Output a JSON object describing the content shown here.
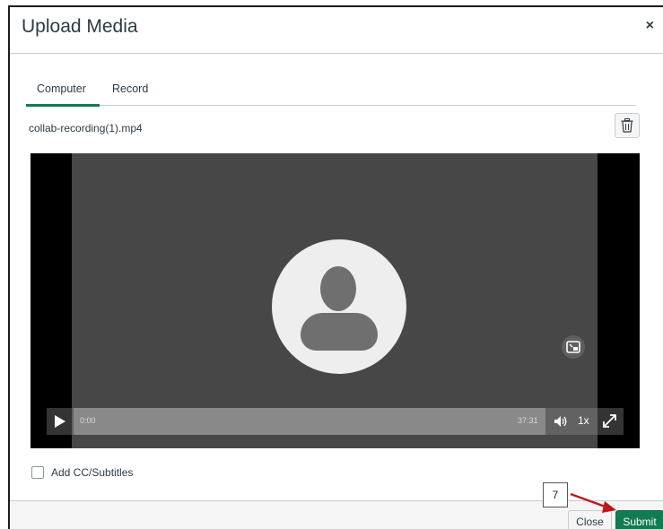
{
  "dialog": {
    "title": "Upload Media",
    "close_symbol": "×"
  },
  "tabs": [
    {
      "label": "Computer",
      "active": true
    },
    {
      "label": "Record",
      "active": false
    }
  ],
  "file": {
    "name": "collab-recording(1).mp4"
  },
  "player": {
    "current_time": "0:00",
    "duration": "37:31",
    "speed": "1x",
    "progress": 0.0
  },
  "captions": {
    "label": "Add CC/Subtitles",
    "checked": false
  },
  "footer": {
    "close_label": "Close",
    "submit_label": "Submit"
  },
  "annotation": {
    "step_number": "7",
    "color": "#c0171c"
  },
  "colors": {
    "accent": "#127b53",
    "text": "#2d3b45"
  }
}
